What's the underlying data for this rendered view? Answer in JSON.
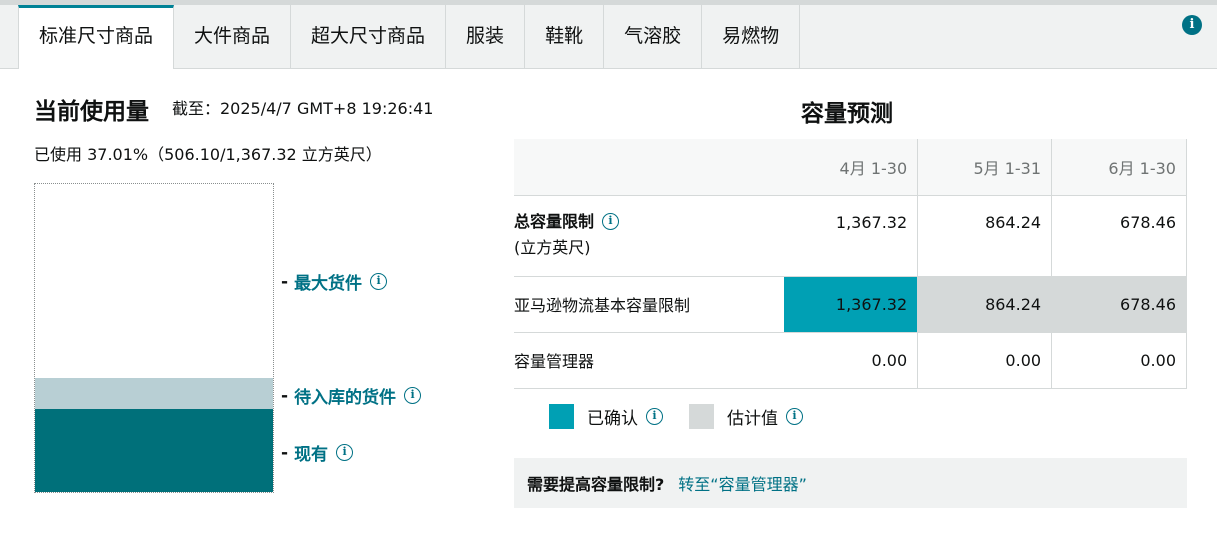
{
  "tabs": [
    {
      "label": "标准尺寸商品"
    },
    {
      "label": "大件商品"
    },
    {
      "label": "超大尺寸商品"
    },
    {
      "label": "服装"
    },
    {
      "label": "鞋靴"
    },
    {
      "label": "气溶胶"
    },
    {
      "label": "易燃物"
    }
  ],
  "active_tab": "标准尺寸商品",
  "usage": {
    "title": "当前使用量",
    "as_of": "截至：2025/4/7 GMT+8 19:26:41",
    "used_text": "已使用 37.01%（506.10/1,367.32 立方英尺）",
    "existing_fraction": 0.27,
    "inbound_fraction": 0.1,
    "markers": {
      "max_inventory": "最大货件",
      "inbound": "待入库的货件",
      "on_hand": "现有"
    }
  },
  "forecast": {
    "title": "容量预测",
    "columns": [
      "4月 1-30",
      "5月 1-31",
      "6月 1-30"
    ],
    "rows": {
      "total": {
        "label": "总容量限制",
        "unit": "(立方英尺)",
        "values": [
          "1,367.32",
          "864.24",
          "678.46"
        ]
      },
      "amazon_base": {
        "label": "亚马逊物流基本容量限制",
        "values": [
          "1,367.32",
          "864.24",
          "678.46"
        ]
      },
      "manager": {
        "label": "容量管理器",
        "values": [
          "0.00",
          "0.00",
          "0.00"
        ]
      }
    },
    "legend": {
      "confirmed": "已确认",
      "estimated": "估计值"
    },
    "colors": {
      "confirmed": "#00a0b4",
      "estimated": "#d5d9d9",
      "existing": "#00707a",
      "inbound": "#b8cfd4",
      "accent": "#007185"
    }
  },
  "cta": {
    "question": "需要提高容量限制?",
    "link": "转至“容量管理器”"
  },
  "icons": {
    "info": "i"
  }
}
